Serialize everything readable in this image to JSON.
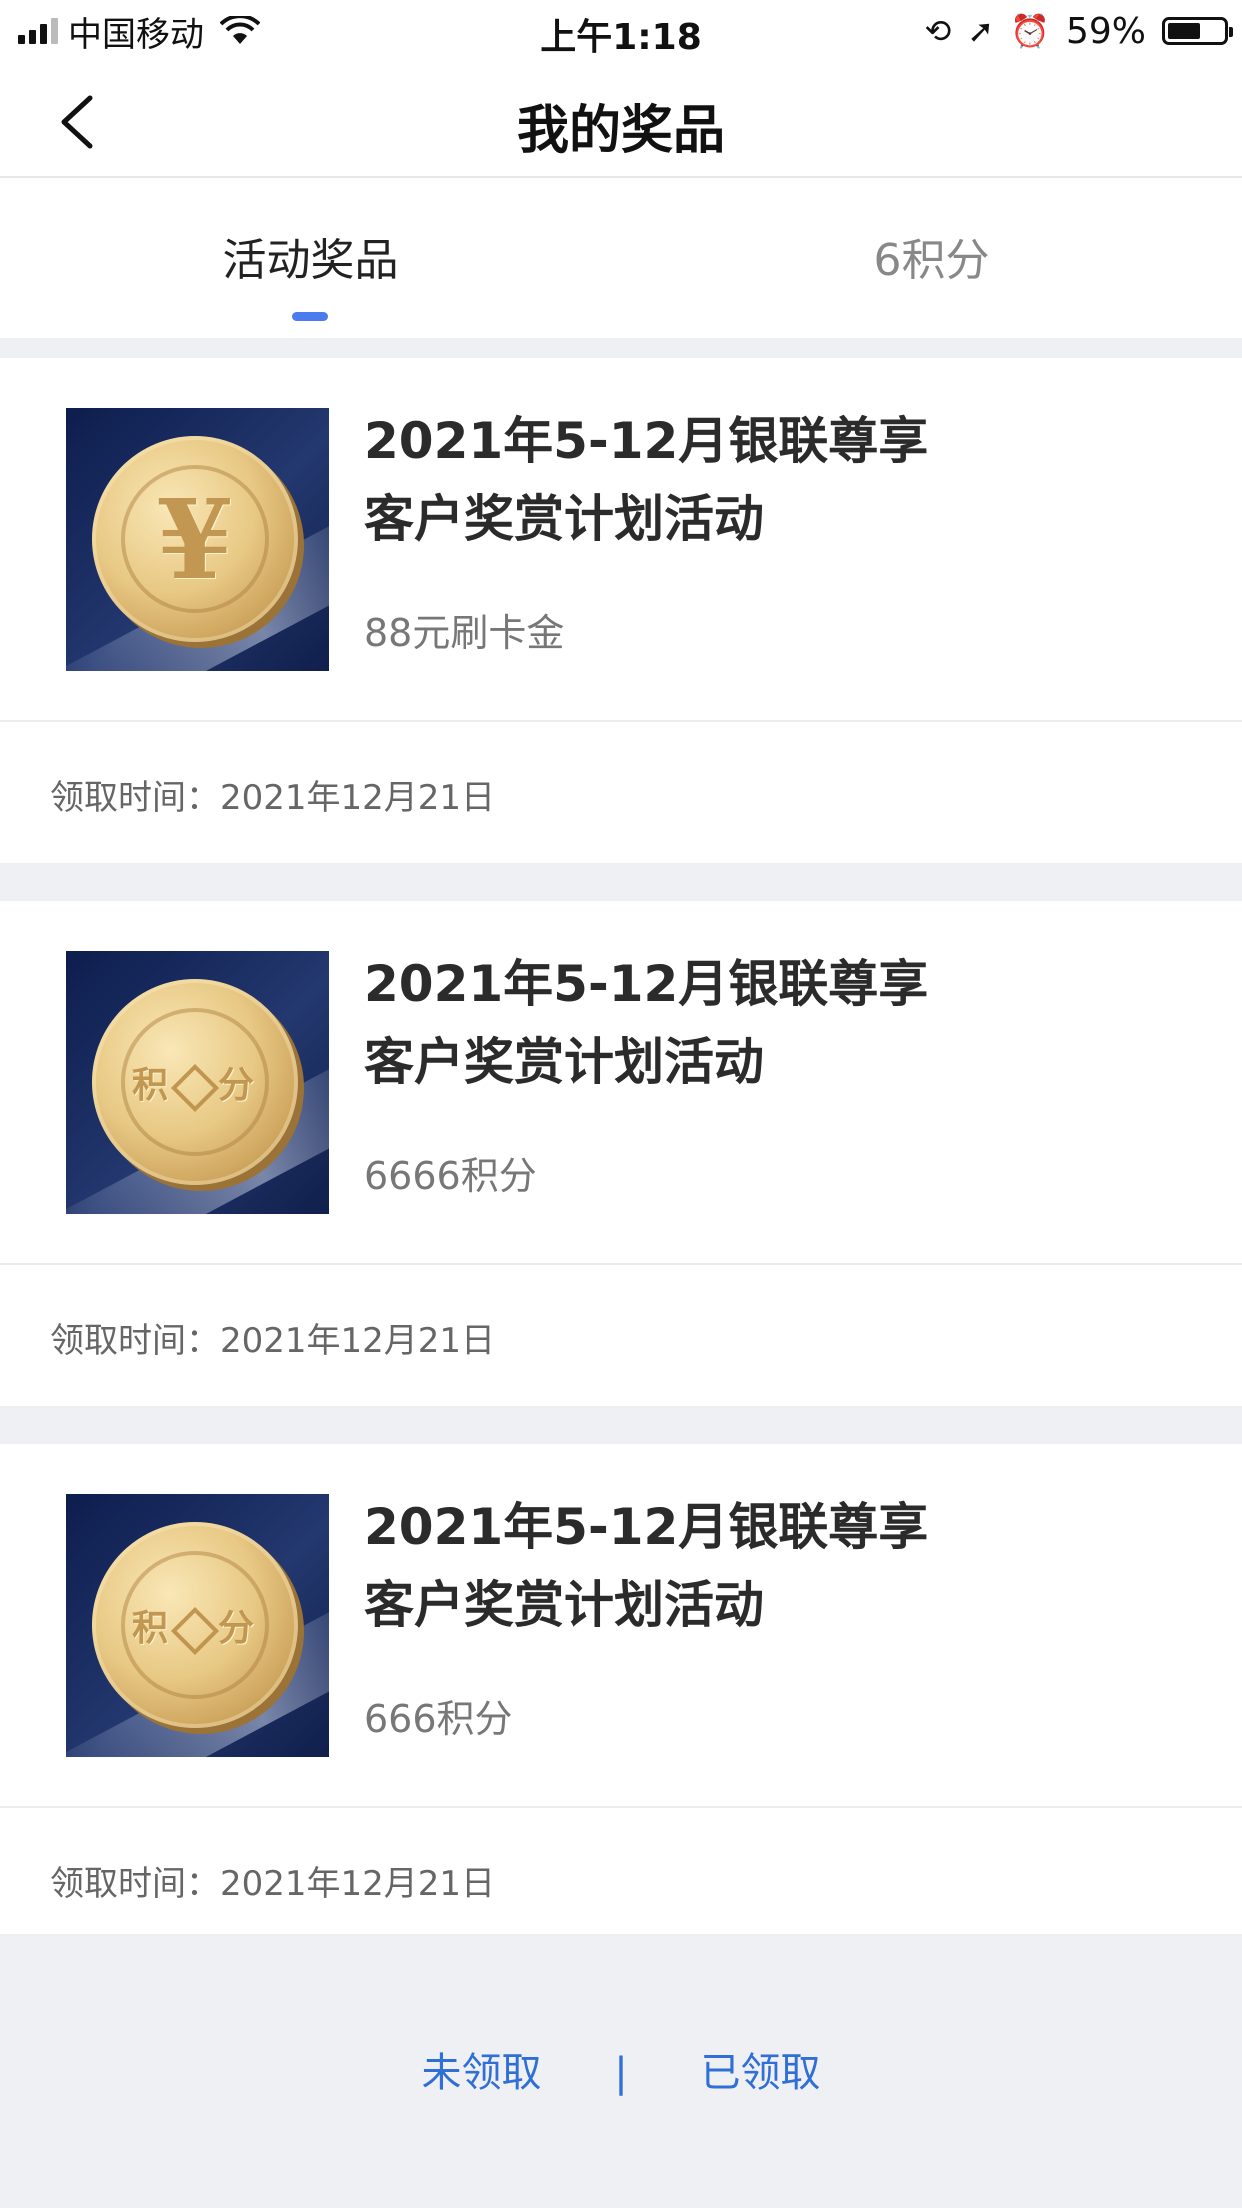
{
  "status_bar": {
    "carrier": "中国移动",
    "time": "上午1:18",
    "battery_percent": "59%",
    "battery_level": 0.59
  },
  "nav": {
    "title": "我的奖品"
  },
  "tabs": [
    {
      "label": "活动奖品",
      "active": true
    },
    {
      "label": "6积分",
      "active": false
    }
  ],
  "prizes": [
    {
      "title_line1": "2021年5-12月银联尊享",
      "title_line2": "客户奖赏计划活动",
      "reward": "88元刷卡金",
      "claim_time": "领取时间：2021年12月21日",
      "icon": "yen-coin-icon"
    },
    {
      "title_line1": "2021年5-12月银联尊享",
      "title_line2": "客户奖赏计划活动",
      "reward": "6666积分",
      "claim_time": "领取时间：2021年12月21日",
      "icon": "points-coin-icon",
      "coin_text_left": "积",
      "coin_text_right": "分"
    },
    {
      "title_line1": "2021年5-12月银联尊享",
      "title_line2": "客户奖赏计划活动",
      "reward": "666积分",
      "claim_time": "领取时间：2021年12月21日",
      "icon": "points-coin-icon",
      "coin_text_left": "积",
      "coin_text_right": "分"
    }
  ],
  "coin_yen_symbol": "¥",
  "bottom_links": {
    "unclaimed": "未领取",
    "separator": "|",
    "claimed": "已领取"
  },
  "colors": {
    "accent": "#4a7cf0",
    "link": "#2f6fd6",
    "background": "#eff0f4"
  }
}
